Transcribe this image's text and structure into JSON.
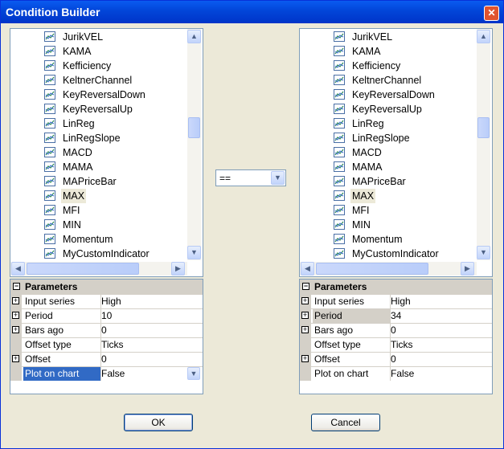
{
  "window": {
    "title": "Condition Builder"
  },
  "indicators": [
    "JurikVEL",
    "KAMA",
    "Kefficiency",
    "KeltnerChannel",
    "KeyReversalDown",
    "KeyReversalUp",
    "LinReg",
    "LinRegSlope",
    "MACD",
    "MAMA",
    "MAPriceBar",
    "MAX",
    "MFI",
    "MIN",
    "Momentum",
    "MyCustomIndicator"
  ],
  "left": {
    "selected_indicator": "MAX",
    "params_header": "Parameters",
    "params": [
      {
        "name": "Input series",
        "value": "High",
        "expandable": true
      },
      {
        "name": "Period",
        "value": "10",
        "expandable": true
      },
      {
        "name": "Bars ago",
        "value": "0",
        "expandable": true
      },
      {
        "name": "Offset type",
        "value": "Ticks",
        "expandable": false
      },
      {
        "name": "Offset",
        "value": "0",
        "expandable": true
      },
      {
        "name": "Plot on chart",
        "value": "False",
        "expandable": false
      }
    ]
  },
  "operator": {
    "value": "=="
  },
  "right": {
    "selected_indicator": "MAX",
    "params_header": "Parameters",
    "params": [
      {
        "name": "Input series",
        "value": "High",
        "expandable": true
      },
      {
        "name": "Period",
        "value": "34",
        "expandable": true
      },
      {
        "name": "Bars ago",
        "value": "0",
        "expandable": true
      },
      {
        "name": "Offset type",
        "value": "Ticks",
        "expandable": false
      },
      {
        "name": "Offset",
        "value": "0",
        "expandable": true
      },
      {
        "name": "Plot on chart",
        "value": "False",
        "expandable": false
      }
    ]
  },
  "buttons": {
    "ok": "OK",
    "cancel": "Cancel"
  },
  "icons": {
    "indicator": "chart-line-icon",
    "close": "close-icon"
  }
}
